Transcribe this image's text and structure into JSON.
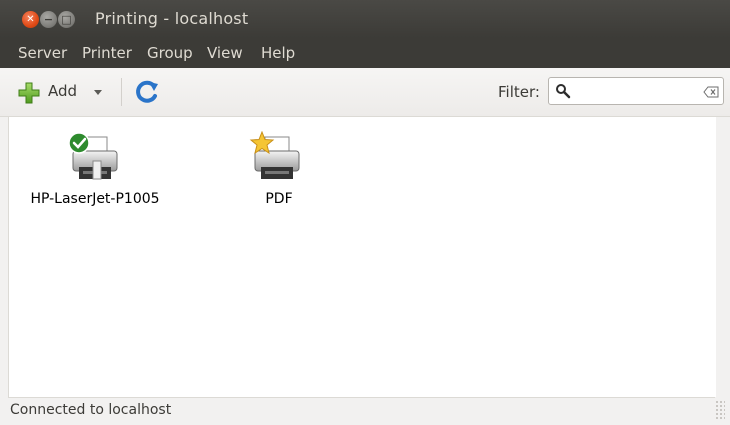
{
  "window": {
    "title": "Printing - localhost"
  },
  "menubar": {
    "items": [
      "Server",
      "Printer",
      "Group",
      "View",
      "Help"
    ]
  },
  "toolbar": {
    "add_label": "Add",
    "filter_label": "Filter:",
    "filter_value": "",
    "icons": {
      "add": "plus-icon",
      "dropdown": "dropdown-arrow-icon",
      "refresh": "refresh-icon",
      "search": "search-icon",
      "clear": "clear-icon"
    }
  },
  "printers": [
    {
      "name": "HP-LaserJet-P1005",
      "badge": "default-check",
      "icon": "printer-icon"
    },
    {
      "name": "PDF",
      "badge": "star",
      "icon": "printer-icon"
    }
  ],
  "status": {
    "text": "Connected to localhost"
  },
  "colors": {
    "titlebar": "#3c3b37",
    "close_button": "#df4a16",
    "default_badge": "#2e8b2e",
    "star": "#f5c533"
  }
}
